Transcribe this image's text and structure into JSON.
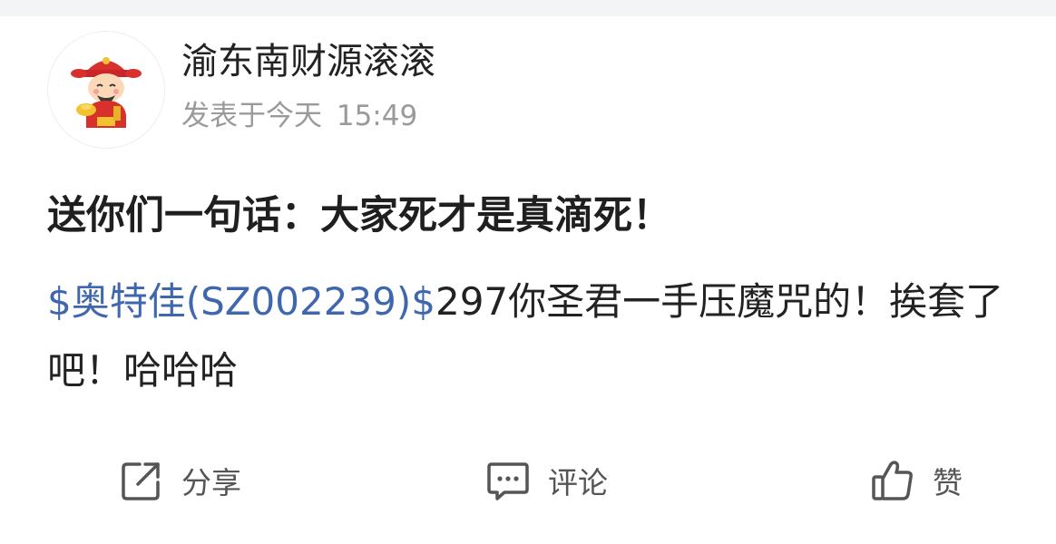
{
  "author": {
    "name": "渝东南财源滚滚",
    "post_time_prefix": "发表于今天",
    "post_time": "15:49",
    "avatar_icon": "fortune-god-avatar-icon"
  },
  "post": {
    "title": "送你们一句话：大家死才是真滴死！",
    "stock_tag": "$奥特佳(SZ002239)$",
    "body_text": "297你圣君一手压魔咒的！挨套了吧！哈哈哈"
  },
  "actions": {
    "share_label": "分享",
    "comment_label": "评论",
    "like_label": "赞"
  },
  "colors": {
    "link": "#3f67ad",
    "text": "#222222",
    "meta": "#9a9a9a",
    "icon": "#555555"
  }
}
